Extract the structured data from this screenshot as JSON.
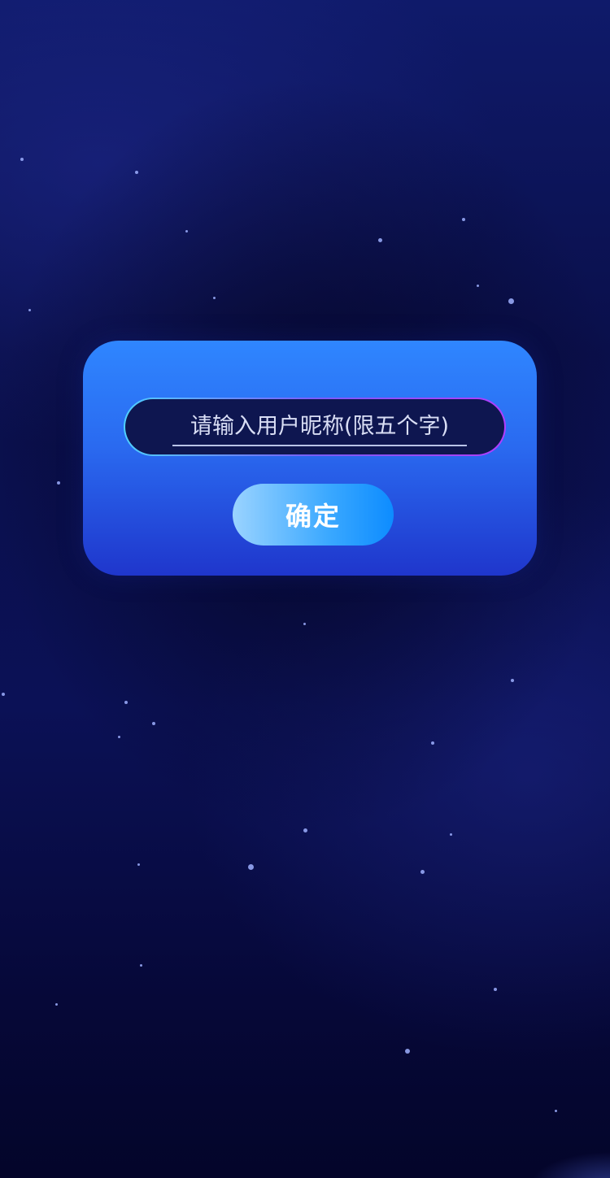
{
  "dialog": {
    "nickname_placeholder": "请输入用户昵称(限五个字)",
    "confirm_label": "确定"
  },
  "colors": {
    "background": "#0a0f4a",
    "dialog_top": "#2f86ff",
    "dialog_bottom": "#1f36cc",
    "input_background": "#0e1650",
    "button_start": "#9ad3ff",
    "button_end": "#0d8cff"
  }
}
